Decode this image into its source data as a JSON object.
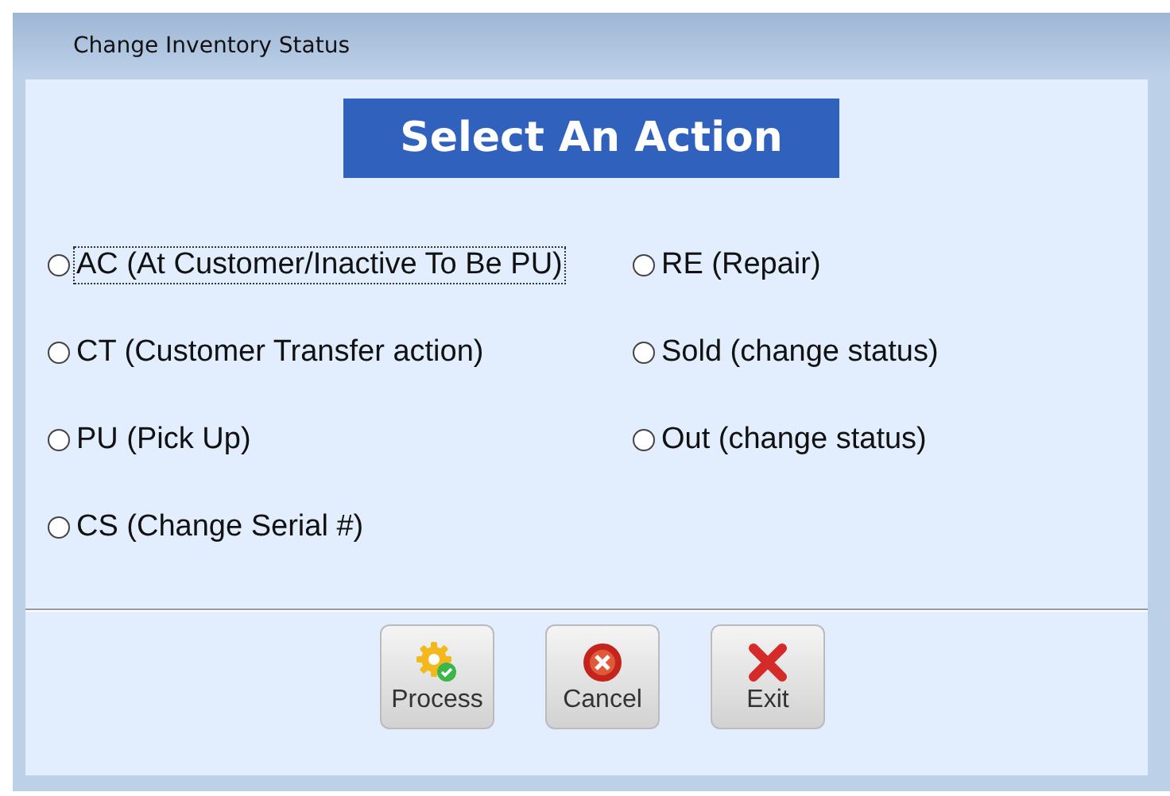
{
  "window": {
    "title": "Change Inventory Status"
  },
  "heading": "Select An Action",
  "option_columns": [
    [
      {
        "label": "AC (At Customer/Inactive To Be PU)",
        "selected": false,
        "focused": true
      },
      {
        "label": "CT (Customer Transfer action)",
        "selected": false,
        "focused": false
      },
      {
        "label": "PU (Pick Up)",
        "selected": false,
        "focused": false
      },
      {
        "label": "CS (Change Serial #)",
        "selected": false,
        "focused": false
      }
    ],
    [
      {
        "label": "RE (Repair)",
        "selected": false,
        "focused": false
      },
      {
        "label": "Sold (change status)",
        "selected": false,
        "focused": false
      },
      {
        "label": "Out (change status)",
        "selected": false,
        "focused": false
      }
    ]
  ],
  "buttons": [
    {
      "label": "Process",
      "kind": "process"
    },
    {
      "label": "Cancel",
      "kind": "cancel"
    },
    {
      "label": "Exit",
      "kind": "exit"
    }
  ]
}
